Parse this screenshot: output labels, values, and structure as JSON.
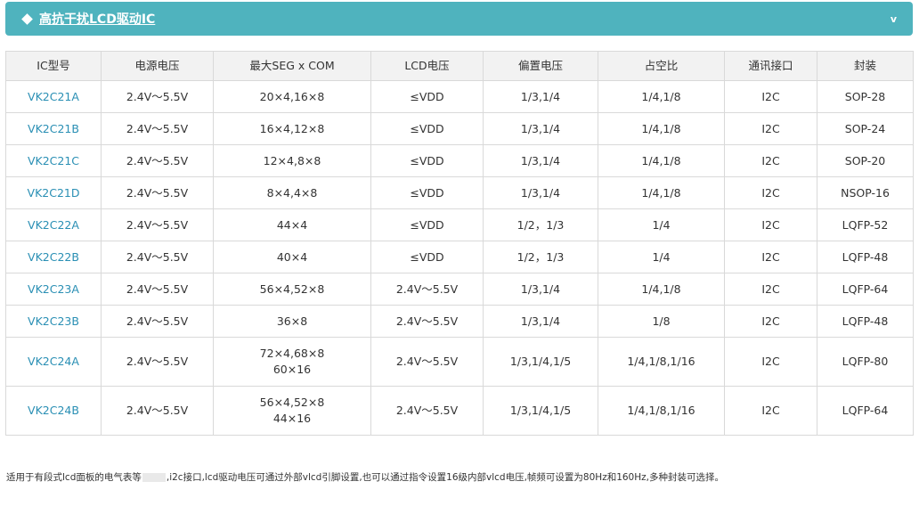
{
  "header": {
    "title": "高抗干扰LCD驱动IC",
    "chevron": "v"
  },
  "table": {
    "columns": [
      "IC型号",
      "电源电压",
      "最大SEG x COM",
      "LCD电压",
      "偏置电压",
      "占空比",
      "通讯接口",
      "封装"
    ],
    "rows": [
      {
        "model": "VK2C21A",
        "supply": "2.4V～5.5V",
        "seg_com": [
          "20×4,16×8"
        ],
        "lcd_v": "≤VDD",
        "bias": "1/3,1/4",
        "duty": "1/4,1/8",
        "iface": "I2C",
        "pkg": "SOP-28"
      },
      {
        "model": "VK2C21B",
        "supply": "2.4V～5.5V",
        "seg_com": [
          "16×4,12×8"
        ],
        "lcd_v": "≤VDD",
        "bias": "1/3,1/4",
        "duty": "1/4,1/8",
        "iface": "I2C",
        "pkg": "SOP-24"
      },
      {
        "model": "VK2C21C",
        "supply": "2.4V～5.5V",
        "seg_com": [
          "12×4,8×8"
        ],
        "lcd_v": "≤VDD",
        "bias": "1/3,1/4",
        "duty": "1/4,1/8",
        "iface": "I2C",
        "pkg": "SOP-20"
      },
      {
        "model": "VK2C21D",
        "supply": "2.4V～5.5V",
        "seg_com": [
          "8×4,4×8"
        ],
        "lcd_v": "≤VDD",
        "bias": "1/3,1/4",
        "duty": "1/4,1/8",
        "iface": "I2C",
        "pkg": "NSOP-16"
      },
      {
        "model": "VK2C22A",
        "supply": "2.4V～5.5V",
        "seg_com": [
          "44×4"
        ],
        "lcd_v": "≤VDD",
        "bias": "1/2，1/3",
        "duty": "1/4",
        "iface": "I2C",
        "pkg": "LQFP-52"
      },
      {
        "model": "VK2C22B",
        "supply": "2.4V～5.5V",
        "seg_com": [
          "40×4"
        ],
        "lcd_v": "≤VDD",
        "bias": "1/2，1/3",
        "duty": "1/4",
        "iface": "I2C",
        "pkg": "LQFP-48"
      },
      {
        "model": "VK2C23A",
        "supply": "2.4V～5.5V",
        "seg_com": [
          "56×4,52×8"
        ],
        "lcd_v": "2.4V～5.5V",
        "bias": "1/3,1/4",
        "duty": "1/4,1/8",
        "iface": "I2C",
        "pkg": "LQFP-64"
      },
      {
        "model": "VK2C23B",
        "supply": "2.4V～5.5V",
        "seg_com": [
          "36×8"
        ],
        "lcd_v": "2.4V～5.5V",
        "bias": "1/3,1/4",
        "duty": "1/8",
        "iface": "I2C",
        "pkg": "LQFP-48"
      },
      {
        "model": "VK2C24A",
        "supply": "2.4V～5.5V",
        "seg_com": [
          "72×4,68×8",
          "60×16"
        ],
        "lcd_v": "2.4V～5.5V",
        "bias": "1/3,1/4,1/5",
        "duty": "1/4,1/8,1/16",
        "iface": "I2C",
        "pkg": "LQFP-80"
      },
      {
        "model": "VK2C24B",
        "supply": "2.4V～5.5V",
        "seg_com": [
          "56×4,52×8",
          "44×16"
        ],
        "lcd_v": "2.4V～5.5V",
        "bias": "1/3,1/4,1/5",
        "duty": "1/4,1/8,1/16",
        "iface": "I2C",
        "pkg": "LQFP-64"
      }
    ]
  },
  "footer": {
    "note_before": "适用于有段式lcd面板的电气表等",
    "note_after": ",i2c接口,lcd驱动电压可通过外部vlcd引脚设置,也可以通过指令设置16级内部vlcd电压,帧频可设置为80Hz和160Hz,多种封装可选择。"
  }
}
